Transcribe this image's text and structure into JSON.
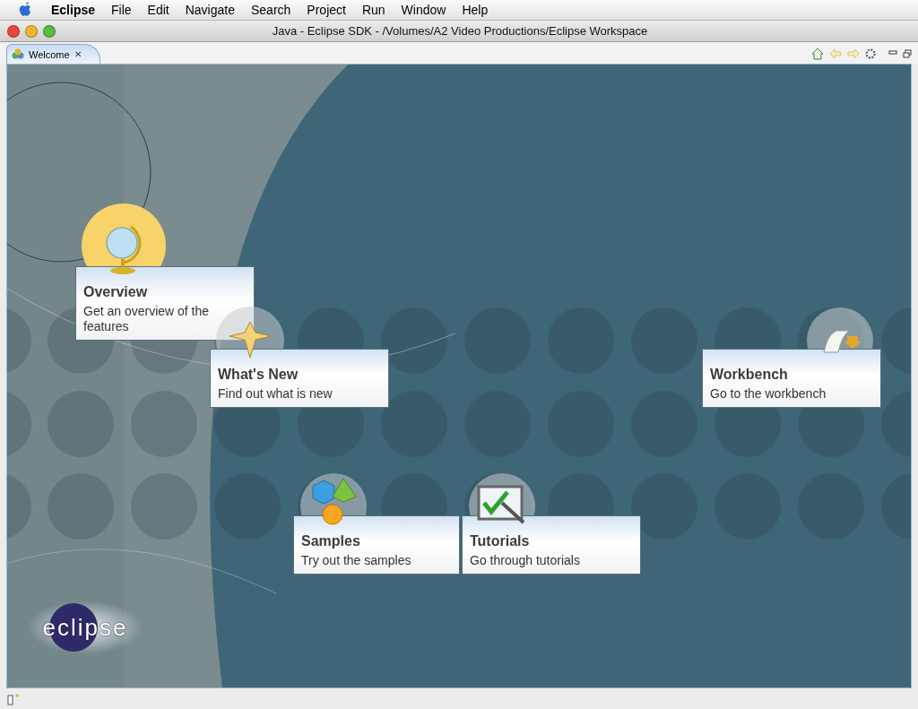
{
  "menu_bar": {
    "app": "Eclipse",
    "items": [
      "File",
      "Edit",
      "Navigate",
      "Search",
      "Project",
      "Run",
      "Window",
      "Help"
    ]
  },
  "window": {
    "title": "Java - Eclipse SDK - /Volumes/A2 Video Productions/Eclipse Workspace"
  },
  "tab": {
    "label": "Welcome",
    "close": "✕"
  },
  "links": [
    {
      "kind": "overview",
      "title": "Overview",
      "description": "Get an overview of the features",
      "hovered": true
    },
    {
      "kind": "whatsnew",
      "title": "What's New",
      "description": "Find out what is new",
      "hovered": false
    },
    {
      "kind": "workbench",
      "title": "Workbench",
      "description": "Go to the workbench",
      "hovered": false
    },
    {
      "kind": "samples",
      "title": "Samples",
      "description": "Try out the samples",
      "hovered": false
    },
    {
      "kind": "tutorials",
      "title": "Tutorials",
      "description": "Go through tutorials",
      "hovered": false
    }
  ],
  "logo": "eclipse"
}
